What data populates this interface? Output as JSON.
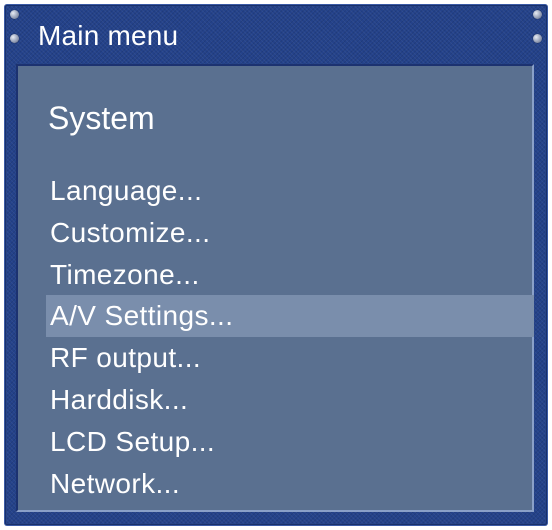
{
  "window": {
    "title": "Main menu"
  },
  "panel": {
    "section_title": "System",
    "selected_index": 3,
    "items": [
      {
        "label": "Language..."
      },
      {
        "label": "Customize..."
      },
      {
        "label": "Timezone..."
      },
      {
        "label": "A/V Settings..."
      },
      {
        "label": "RF output..."
      },
      {
        "label": "Harddisk..."
      },
      {
        "label": "LCD Setup..."
      },
      {
        "label": "Network..."
      }
    ]
  },
  "colors": {
    "frame": "#24428a",
    "panel": "#5a7090",
    "highlight": "#7a8eac",
    "text": "#ffffff"
  }
}
